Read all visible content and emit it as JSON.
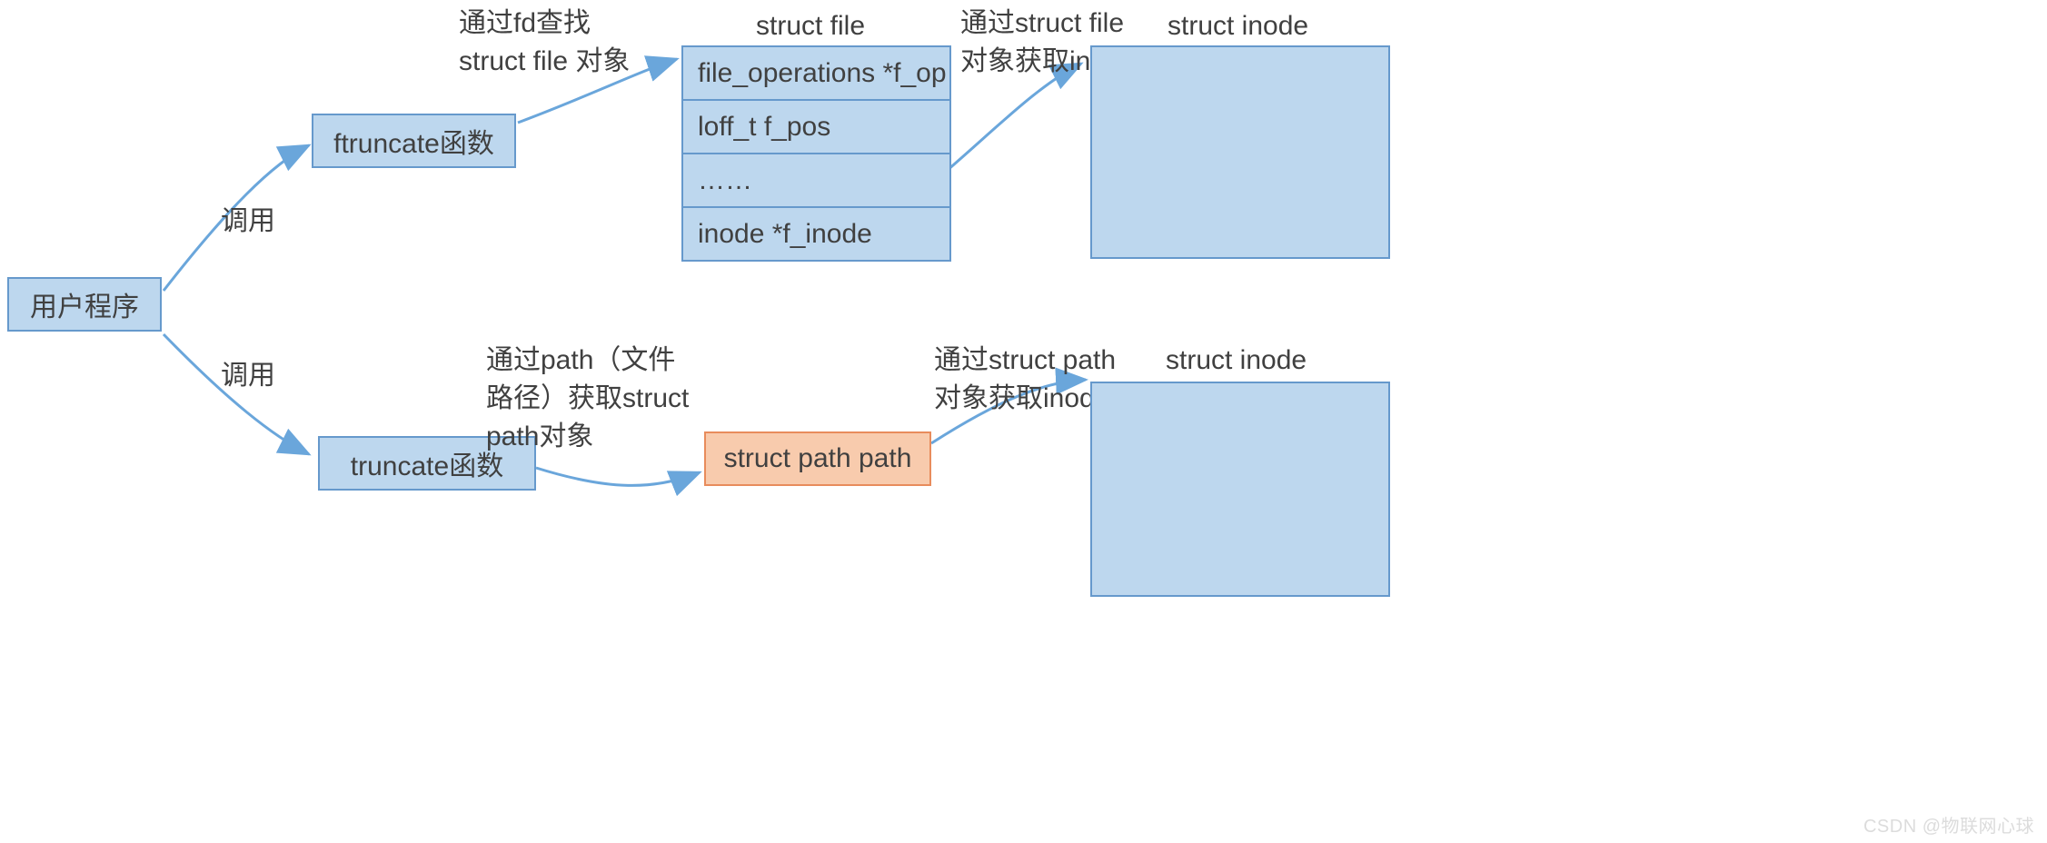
{
  "nodes": {
    "user_program": "用户程序",
    "ftruncate_func": "ftruncate函数",
    "truncate_func": "truncate函数",
    "struct_path_path": "struct path path"
  },
  "labels": {
    "call_top": "调用",
    "call_bottom": "调用",
    "fd_lookup_line1": "通过fd查找",
    "fd_lookup_line2": "struct file 对象",
    "path_lookup_line1": "通过path（文件",
    "path_lookup_line2": "路径）获取struct",
    "path_lookup_line3": "path对象",
    "struct_file_title": "struct file",
    "struct_file_to_inode_line1": "通过struct file",
    "struct_file_to_inode_line2": "对象获取inode",
    "struct_path_to_inode_line1": "通过struct path",
    "struct_path_to_inode_line2": "对象获取inode",
    "struct_inode_top": "struct inode",
    "struct_inode_bottom": "struct inode"
  },
  "struct_file_rows": {
    "r0": "file_operations *f_op",
    "r1": "loff_t f_pos",
    "r2": "……",
    "r3": "inode *f_inode"
  },
  "watermark": "CSDN @物联网心球"
}
